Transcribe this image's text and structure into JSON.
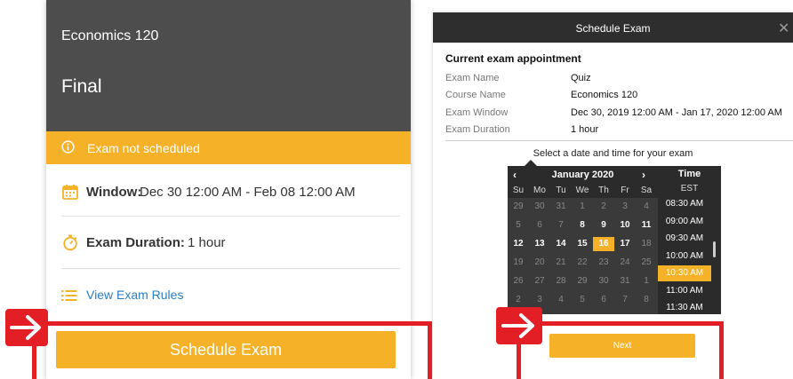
{
  "left_card": {
    "course": "Economics 120",
    "exam": "Final",
    "status": "Exam not scheduled",
    "window_label": "Window:",
    "window_value": "Dec 30 12:00 AM - Feb 08 12:00 AM",
    "duration_label": "Exam Duration:",
    "duration_value": "1 hour",
    "rules_link": "View Exam Rules",
    "schedule_button": "Schedule Exam"
  },
  "dialog": {
    "title": "Schedule Exam",
    "close_glyph": "✕",
    "heading": "Current exam appointment",
    "details": [
      {
        "label": "Exam Name",
        "value": "Quiz"
      },
      {
        "label": "Course Name",
        "value": "Economics 120"
      },
      {
        "label": "Exam Window",
        "value": "Dec 30, 2019 12:00 AM - Jan 17, 2020 12:00 AM"
      },
      {
        "label": "Exam Duration",
        "value": "1 hour"
      }
    ],
    "prompt": "Select a date and time for your exam",
    "calendar": {
      "month": "January 2020",
      "prev": "‹",
      "next": "›",
      "weekdays": [
        "Su",
        "Mo",
        "Tu",
        "We",
        "Th",
        "Fr",
        "Sa"
      ],
      "weeks": [
        [
          "29",
          "30",
          "31",
          "1",
          "2",
          "3",
          "4"
        ],
        [
          "5",
          "6",
          "7",
          "8",
          "9",
          "10",
          "11"
        ],
        [
          "12",
          "13",
          "14",
          "15",
          "16",
          "17",
          "18"
        ],
        [
          "19",
          "20",
          "21",
          "22",
          "23",
          "24",
          "25"
        ],
        [
          "26",
          "27",
          "28",
          "29",
          "30",
          "31",
          "1"
        ],
        [
          "2",
          "3",
          "4",
          "5",
          "6",
          "7",
          "8"
        ]
      ],
      "available": [
        [
          1,
          3
        ],
        [
          1,
          4
        ],
        [
          1,
          5
        ],
        [
          1,
          6
        ],
        [
          2,
          0
        ],
        [
          2,
          1
        ],
        [
          2,
          2
        ],
        [
          2,
          3
        ],
        [
          2,
          5
        ]
      ],
      "selected": [
        2,
        4
      ]
    },
    "time": {
      "title": "Time",
      "timezone": "EST",
      "slots": [
        "08:30 AM",
        "09:00 AM",
        "09:30 AM",
        "10:00 AM",
        "10:30 AM",
        "11:00 AM",
        "11:30 AM"
      ],
      "selected_index": 4
    },
    "next_button": "Next"
  },
  "colors": {
    "accent": "#f5b229",
    "header_dark": "#4d4d4d",
    "link_blue": "#2a7ec2",
    "highlight_red": "#e31e25"
  }
}
